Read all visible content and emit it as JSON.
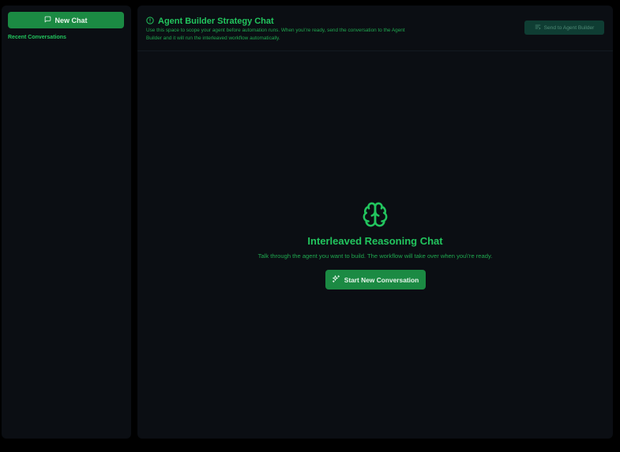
{
  "sidebar": {
    "new_chat_label": "New Chat",
    "new_chat_icon": "message-square-icon",
    "recent_label": "Recent Conversations",
    "conversations": []
  },
  "header": {
    "icon": "info-circle-icon",
    "title": "Agent Builder Strategy Chat",
    "subtitle": "Use this space to scope your agent before automation runs. When you\\'re ready, send the conversation to the Agent Builder and it will run the interleaved workflow automatically.",
    "send_label": "Send to Agent Builder",
    "send_icon": "send-list-icon",
    "send_disabled": true
  },
  "empty_state": {
    "icon": "brain-icon",
    "title": "Interleaved Reasoning Chat",
    "description": "Talk through the agent you want to build. The workflow will take over when you\\'re ready.",
    "start_label": "Start New Conversation",
    "start_icon": "sparkles-icon"
  },
  "colors": {
    "background": "#000000",
    "panel": "#0b0e13",
    "accent": "#22c55e",
    "button": "#1b8a43",
    "button_disabled": "#0f3d33"
  }
}
